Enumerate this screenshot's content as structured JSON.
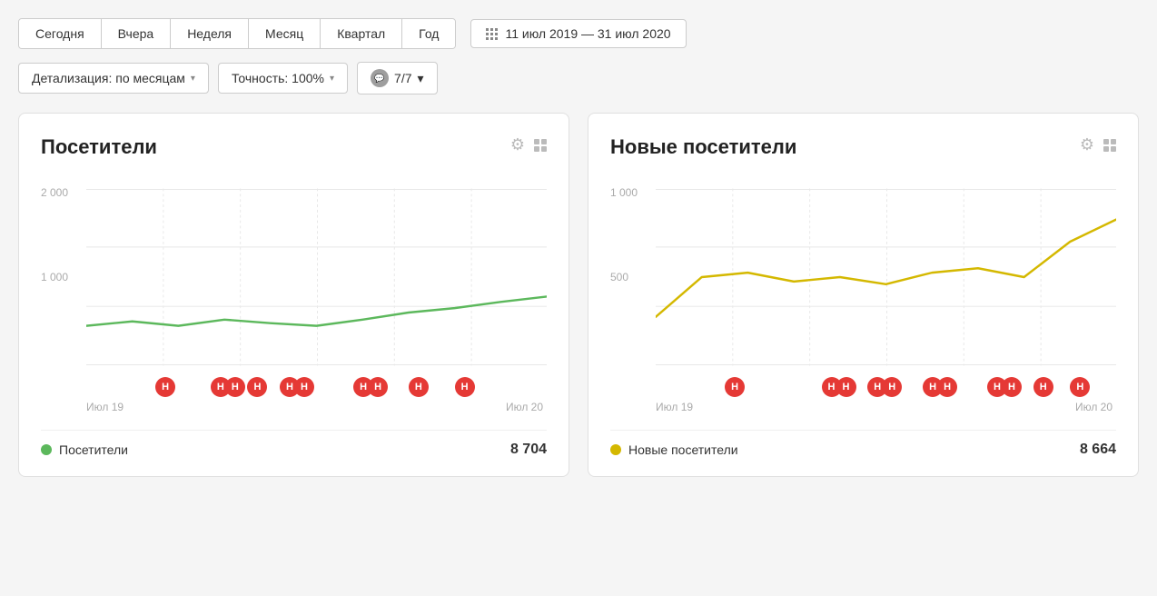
{
  "periods": {
    "buttons": [
      "Сегодня",
      "Вчера",
      "Неделя",
      "Месяц",
      "Квартал",
      "Год"
    ],
    "date_range": "11 июл 2019 — 31 июл 2020"
  },
  "filters": {
    "detail": "Детализация: по месяцам",
    "accuracy": "Точность: 100%",
    "comments": "7/7"
  },
  "chart1": {
    "title": "Посетители",
    "y_labels": [
      "2 000",
      "1 000"
    ],
    "x_labels": [
      "Июл 19",
      "Июл 20"
    ],
    "legend_label": "Посетители",
    "legend_value": "8 704",
    "dot_color": "#5cb85c",
    "line_color": "#5cb85c"
  },
  "chart2": {
    "title": "Новые посетители",
    "y_labels": [
      "1 000",
      "500"
    ],
    "x_labels": [
      "Июл 19",
      "Июл 20"
    ],
    "legend_label": "Новые посетители",
    "legend_value": "8 664",
    "dot_color": "#d4b800",
    "line_color": "#d4b800"
  },
  "icons": {
    "gear": "⚙",
    "grid": "⊞",
    "chevron_down": "▾",
    "calendar": "▦"
  }
}
